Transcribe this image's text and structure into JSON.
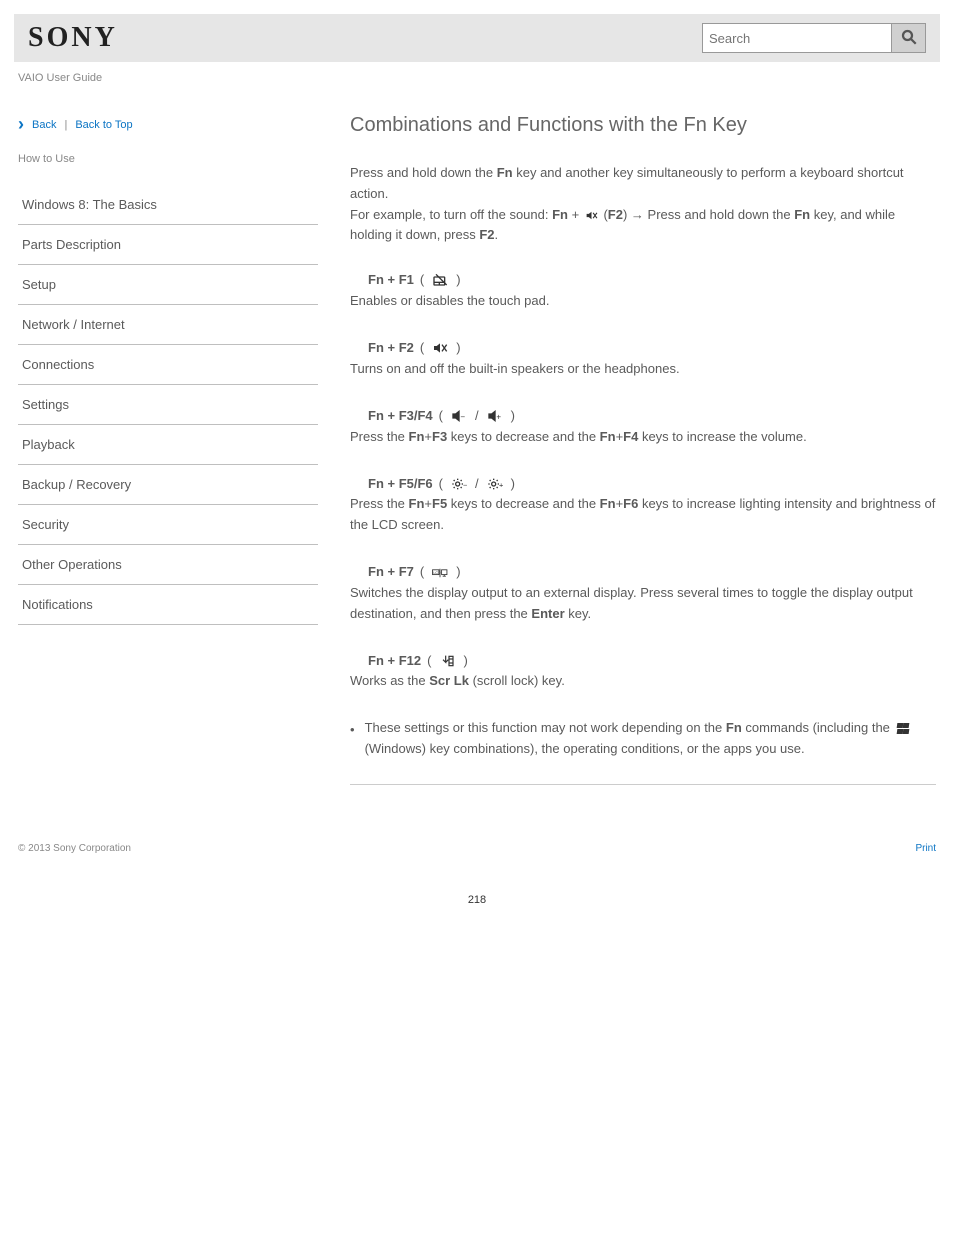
{
  "header": {
    "brand": "SONY",
    "product": "VAIO User Guide",
    "search_placeholder": "Search"
  },
  "breadcrumb": {
    "back": "Back",
    "top": "Back to Top"
  },
  "howto_label": "How to Use",
  "sidebar": {
    "items": [
      "Windows 8: The Basics",
      "Parts Description",
      "Setup",
      "Network / Internet",
      "Connections",
      "Settings",
      "Playback",
      "Backup / Recovery",
      "Security",
      "Other Operations",
      "Notifications"
    ]
  },
  "main": {
    "title": "Combinations and Functions with the Fn Key",
    "intro_lead": "Press and hold down the ",
    "intro_key": "Fn",
    "intro_mid": " key and another key simultaneously to perform a keyboard shortcut action.",
    "intro_example_pre": "For example, to turn off the sound: ",
    "intro_example_combo1": "Fn",
    "intro_example_plus": " + ",
    "intro_example_combo2a": "F2",
    "intro_arrow": " → Press and hold down the ",
    "intro_example_combo2b": "Fn",
    "intro_example_tail": " key, and while holding it down, press ",
    "intro_example_combo3": "F2",
    "rows": [
      {
        "keys": "Fn + F1",
        "iconset": "touchpad-off",
        "desc": "Enables or disables the touch pad."
      },
      {
        "keys": "Fn + F2",
        "iconset": "mute",
        "desc": "Turns on and off the built-in speakers or the headphones."
      },
      {
        "keys": "Fn + F3/F4",
        "iconset": "volume",
        "desc_pre": "Press the ",
        "desc_k1": "Fn",
        "desc_plus1": "+",
        "desc_k2": "F3",
        "desc_mid1": " keys to decrease and the ",
        "desc_k3": "Fn",
        "desc_plus2": "+",
        "desc_k4": "F4",
        "desc_tail": " keys to increase the volume."
      },
      {
        "keys": "Fn + F5/F6",
        "iconset": "brightness",
        "desc_pre": "Press the ",
        "desc_k1": "Fn",
        "desc_plus1": "+",
        "desc_k2": "F5",
        "desc_mid1": " keys to decrease and the ",
        "desc_k3": "Fn",
        "desc_plus2": "+",
        "desc_k4": "F6",
        "desc_tail": " keys to increase lighting intensity and brightness of the LCD screen."
      },
      {
        "keys": "Fn + F7",
        "iconset": "display",
        "desc": "Switches the display output to an external display. Press several times to toggle the display output destination, and then press the ",
        "desc_k1": "Enter",
        "desc_tail": " key."
      },
      {
        "keys": "Fn + F12",
        "iconset": "scrlk",
        "desc_pre": "Works as the ",
        "desc_k1": "Scr Lk",
        "desc_tail": " (scroll lock) key."
      }
    ],
    "note_pre": "These settings or this function may not work depending on the ",
    "note_key": "Fn",
    "note_mid": " commands (including the ",
    "note_win_pre": "",
    "note_win_post": " (Windows) key combinations), the operating conditions, or the apps you use."
  },
  "footer": {
    "left": "© 2013 Sony Corporation",
    "right": "Print"
  },
  "page_number": "218"
}
